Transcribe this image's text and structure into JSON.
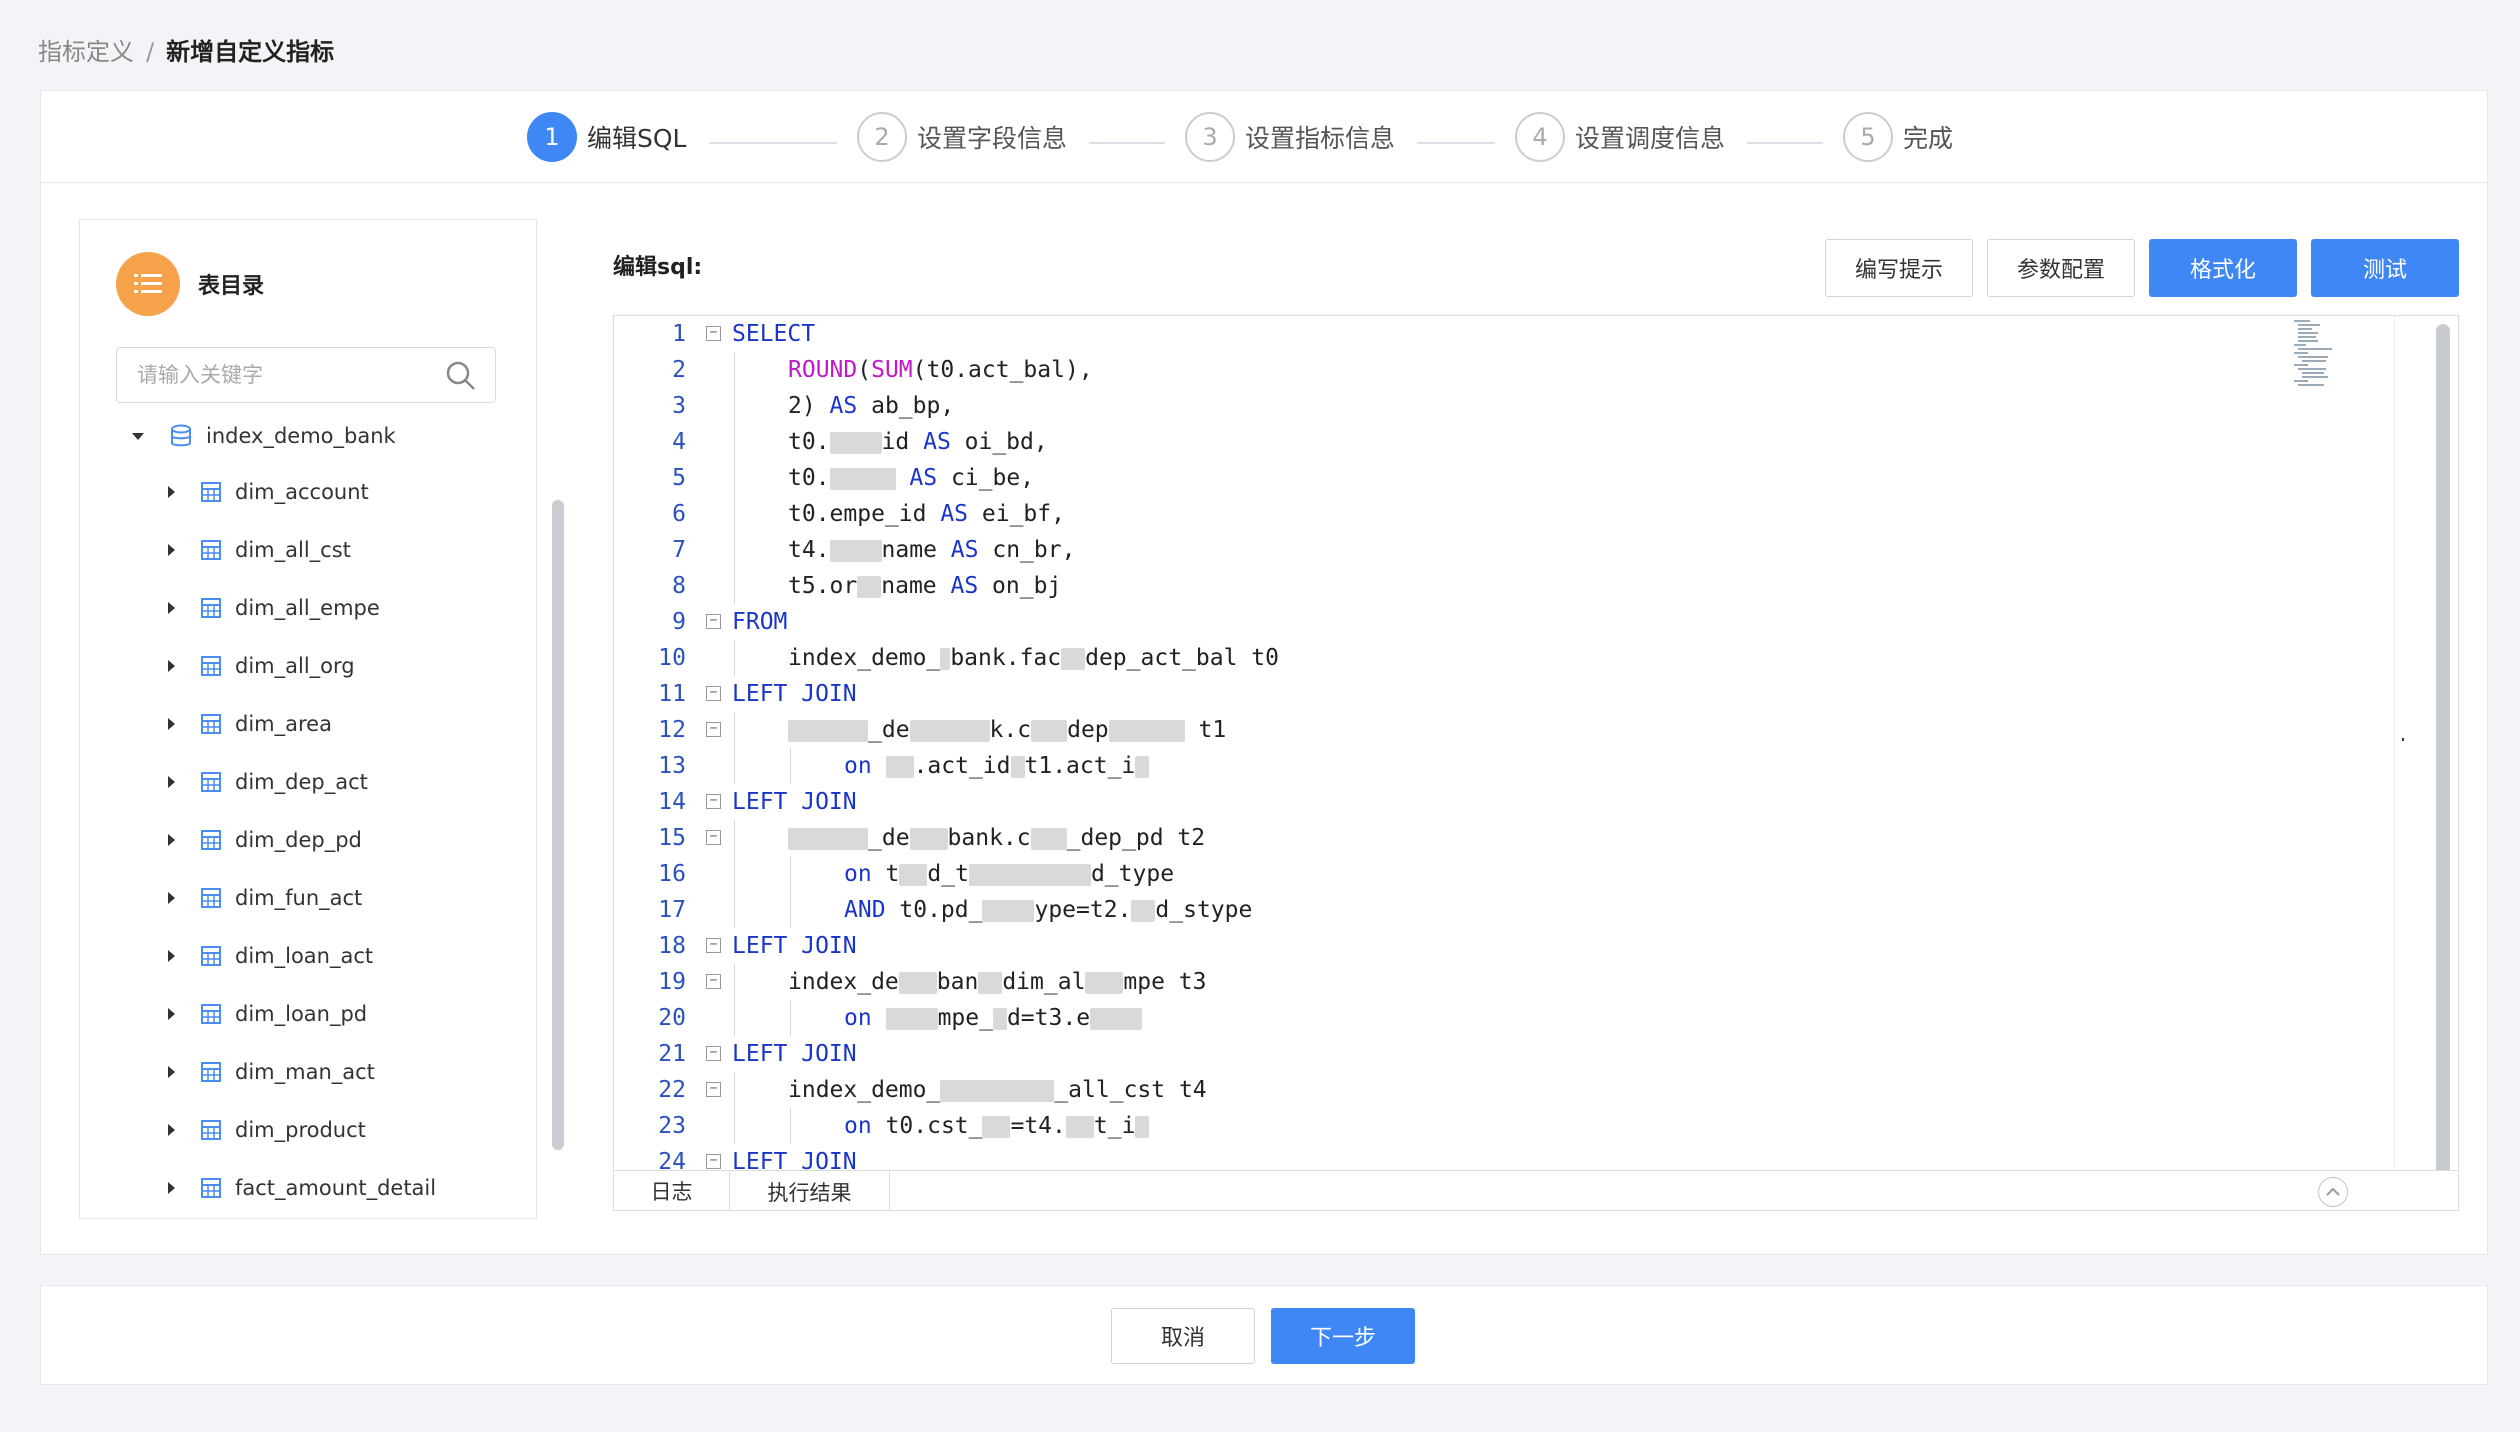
{
  "breadcrumb": {
    "parent": "指标定义",
    "separator": "/",
    "current": "新增自定义指标"
  },
  "steps": [
    {
      "number": "1",
      "label": "编辑SQL",
      "active": true
    },
    {
      "number": "2",
      "label": "设置字段信息",
      "active": false
    },
    {
      "number": "3",
      "label": "设置指标信息",
      "active": false
    },
    {
      "number": "4",
      "label": "设置调度信息",
      "active": false
    },
    {
      "number": "5",
      "label": "完成",
      "active": false
    }
  ],
  "sidebar": {
    "title": "表目录",
    "search_placeholder": "请输入关键字",
    "database": "index_demo_bank",
    "tables": [
      "dim_account",
      "dim_all_cst",
      "dim_all_empe",
      "dim_all_org",
      "dim_area",
      "dim_dep_act",
      "dim_dep_pd",
      "dim_fun_act",
      "dim_loan_act",
      "dim_loan_pd",
      "dim_man_act",
      "dim_product",
      "fact_amount_detail"
    ]
  },
  "editor": {
    "label": "编辑sql:",
    "buttons": {
      "hint": "编写提示",
      "params": "参数配置",
      "format": "格式化",
      "test": "测试"
    },
    "line_numbers": [
      "1",
      "2",
      "3",
      "4",
      "5",
      "6",
      "7",
      "8",
      "9",
      "10",
      "11",
      "12",
      "13",
      "14",
      "15",
      "16",
      "17",
      "18",
      "19",
      "20",
      "21",
      "22",
      "23",
      "24"
    ],
    "code": {
      "l1": "SELECT",
      "l2a": "ROUND",
      "l2b": "(",
      "l2c": "SUM",
      "l2d": "(t0.act_bal),",
      "l3a": "2) ",
      "l3b": "AS",
      "l3c": " ab_bp,",
      "l4a": "t0.",
      "l4b": "id ",
      "l4c": "AS",
      "l4d": " oi_bd,",
      "l5a": "t0.",
      "l5b": " ",
      "l5c": "AS",
      "l5d": " ci_be,",
      "l6a": "t0.empe_id ",
      "l6b": "AS",
      "l6c": " ei_bf,",
      "l7a": "t4.",
      "l7b": "name ",
      "l7c": "AS",
      "l7d": " cn_br,",
      "l8a": "t5.or",
      "l8b": "name ",
      "l8c": "AS",
      "l8d": " on_bj",
      "l9": "FROM",
      "l10a": "index_demo_",
      "l10b": "bank.fac",
      "l10c": "dep_act_bal t0",
      "l11": "LEFT JOIN",
      "l12a": "_de",
      "l12b": "k.c",
      "l12c": "dep",
      "l12d": " t1",
      "l13a": "on",
      "l13b": " ",
      "l13c": ".act_id",
      "l13d": "t1.act_i",
      "l14": "LEFT JOIN",
      "l15a": "_de",
      "l15b": "bank.c",
      "l15c": "_dep_pd t2",
      "l16a": "on",
      "l16b": " t",
      "l16c": "d_t",
      "l16d": "d_type",
      "l17a": "AND",
      "l17b": " t0.pd_",
      "l17c": "ype=t2.",
      "l17d": "d_stype",
      "l18": "LEFT JOIN",
      "l19a": "index_de",
      "l19b": "ban",
      "l19c": "dim_al",
      "l19d": "mpe t3",
      "l20a": "on",
      "l20b": " ",
      "l20c": "mpe_",
      "l20d": "d=t3.e",
      "l21": "LEFT JOIN",
      "l22a": "index_demo_",
      "l22b": "_all_cst t4",
      "l23a": "on",
      "l23b": " t0.cst_",
      "l23c": "=t4.",
      "l23d": "t_i",
      "l24": "LEFT JOIN"
    },
    "tabs": {
      "log": "日志",
      "result": "执行结果"
    }
  },
  "footer": {
    "cancel": "取消",
    "next": "下一步"
  },
  "colors": {
    "primary": "#3f87f5",
    "catalog_icon": "#f6a24b",
    "keyword": "#1a36c9",
    "function": "#c019c9"
  }
}
